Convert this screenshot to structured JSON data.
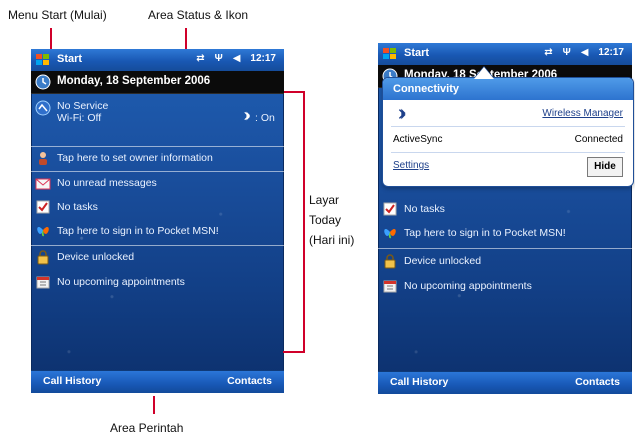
{
  "annotations": {
    "menu_start": "Menu Start (Mulai)",
    "status_area": "Area Status & Ikon",
    "today_screen": [
      "Layar",
      "Today",
      "(Hari ini)"
    ],
    "command_area": "Area Perintah"
  },
  "left_screen": {
    "topbar": {
      "start_label": "Start",
      "time": "12:17"
    },
    "date": "Monday, 18 September 2006",
    "items": {
      "network_line1": "No Service",
      "network_line2": "Wi-Fi: Off",
      "bluetooth": ": On",
      "owner": "Tap here to set owner information",
      "messages": "No unread messages",
      "tasks": "No tasks",
      "msn": "Tap here to sign in to Pocket MSN!",
      "device": "Device unlocked",
      "appointments": "No upcoming appointments"
    },
    "softkeys": {
      "left": "Call History",
      "right": "Contacts"
    }
  },
  "right_screen": {
    "topbar": {
      "start_label": "Start",
      "time": "12:17"
    },
    "partial_date": "Monday, 18 September 2006",
    "popup": {
      "title": "Connectivity",
      "rows": [
        {
          "left_icon": "bluetooth-icon",
          "right_link": "Wireless Manager"
        },
        {
          "left": "ActiveSync",
          "right": "Connected"
        },
        {
          "left_link": "Settings",
          "button": "Hide"
        }
      ]
    },
    "items": {
      "tasks": "No tasks",
      "msn": "Tap here to sign in to Pocket MSN!",
      "device": "Device unlocked",
      "appointments": "No upcoming appointments"
    },
    "softkeys": {
      "left": "Call History",
      "right": "Contacts"
    }
  },
  "colors": {
    "accent_red": "#d0002a",
    "wm_blue": "#1a4f9e",
    "popup_title_blue": "#2d73cf"
  }
}
